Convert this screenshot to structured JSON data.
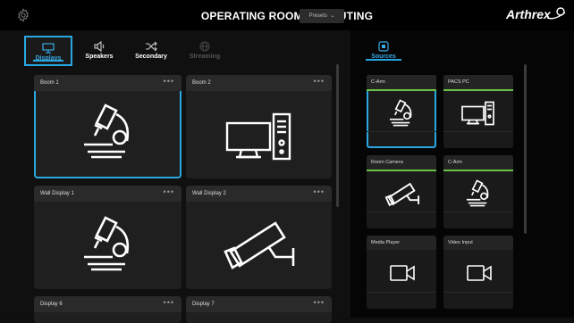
{
  "header": {
    "title": "OPERATING ROOM 6 - ROUTING",
    "logo": "Arthrex"
  },
  "tabs": [
    {
      "label": "Displays",
      "icon": "monitor-icon",
      "selected": true
    },
    {
      "label": "Speakers",
      "icon": "speaker-icon"
    },
    {
      "label": "Secondary",
      "icon": "shuffle-icon"
    },
    {
      "label": "Streaming",
      "icon": "globe-icon",
      "disabled": true
    }
  ],
  "presets": {
    "label": "Presets"
  },
  "sources_tab": {
    "label": "Sources"
  },
  "displays": [
    {
      "name": "Boom 1",
      "icon": "microscope-icon",
      "selected": true
    },
    {
      "name": "Boom 2",
      "icon": "desktop-pc-icon"
    },
    {
      "name": "Wall Display 1",
      "icon": "microscope-icon"
    },
    {
      "name": "Wall Display 2",
      "icon": "camera-icon"
    },
    {
      "name": "Display 6",
      "icon": ""
    },
    {
      "name": "Display 7",
      "icon": ""
    }
  ],
  "menu_dots": "•••",
  "sources": [
    {
      "name": "C-Arm",
      "icon": "microscope-icon",
      "active": true,
      "selected": true
    },
    {
      "name": "PACS PC",
      "icon": "desktop-pc-icon",
      "active": true
    },
    {
      "name": "Room Camera",
      "icon": "camera-icon",
      "active": true
    },
    {
      "name": "C-Arm",
      "icon": "microscope-icon",
      "active": true
    },
    {
      "name": "Media Player",
      "icon": "video-camera-icon"
    },
    {
      "name": "Video Input",
      "icon": "video-camera-icon"
    }
  ],
  "colors": {
    "accent": "#2aa7e0",
    "active": "#6cc043"
  }
}
